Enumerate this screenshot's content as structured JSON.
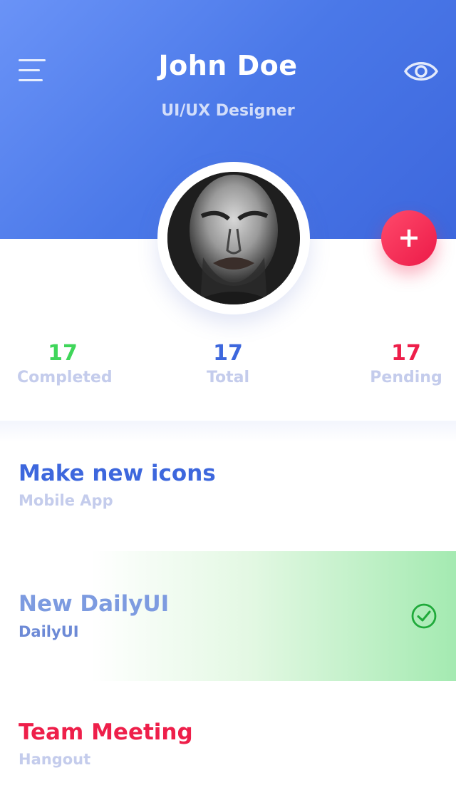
{
  "header": {
    "name": "John Doe",
    "role": "UI/UX Designer",
    "menu_icon": "hamburger-menu-icon",
    "eye_icon": "eye-icon"
  },
  "fab": {
    "label": "+"
  },
  "stats": [
    {
      "value": "17",
      "label": "Completed",
      "color": "#3fd65a"
    },
    {
      "value": "17",
      "label": "Total",
      "color": "#3d67dd"
    },
    {
      "value": "17",
      "label": "Pending",
      "color": "#ee1f4a"
    }
  ],
  "tasks": [
    {
      "title": "Make new icons",
      "subtitle": "Mobile App",
      "title_color": "#3d67dd",
      "sub_color": "#c4ccec",
      "done": false
    },
    {
      "title": "New DailyUI",
      "subtitle": "DailyUI",
      "title_color": "#7d9be0",
      "sub_color": "#7d9be0",
      "done": true,
      "status_icon": "check-circle-icon"
    },
    {
      "title": "Team Meeting",
      "subtitle": "Hangout",
      "title_color": "#ee1f4a",
      "sub_color": "#c4ccec",
      "done": false
    }
  ],
  "colors": {
    "header_gradient_start": "#6a93f7",
    "header_gradient_end": "#3d67dd",
    "accent_red": "#ee1f4a",
    "accent_green": "#3fd65a"
  }
}
